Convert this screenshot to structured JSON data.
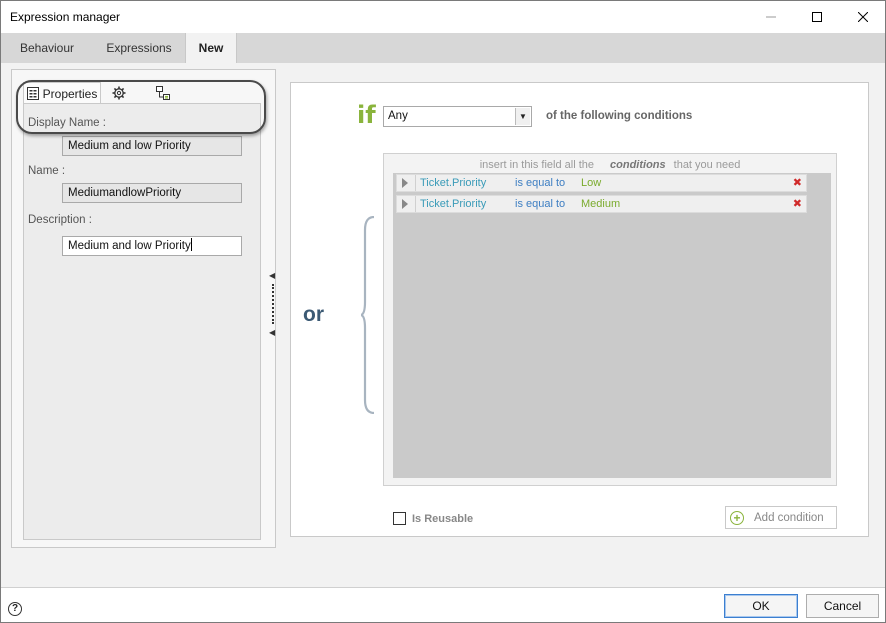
{
  "window": {
    "title": "Expression manager",
    "controls": {
      "minimize": "minimize-icon",
      "maximize": "maximize-icon",
      "close": "close-icon"
    }
  },
  "tabs": [
    {
      "label": "Behaviour",
      "active": false
    },
    {
      "label": "Expressions",
      "active": false
    },
    {
      "label": "New",
      "active": true
    }
  ],
  "left_panel": {
    "subtabs": [
      {
        "label": "Properties",
        "icon": "properties-icon"
      },
      {
        "label": "",
        "icon": "gear-icon"
      },
      {
        "label": "",
        "icon": "tree-icon"
      }
    ],
    "fields": {
      "display_name": {
        "label": "Display Name :",
        "value": "Medium and low Priority"
      },
      "name": {
        "label": "Name :",
        "value": "MediumandlowPriority"
      },
      "description": {
        "label": "Description :",
        "value": "Medium and low Priority"
      }
    }
  },
  "right_panel": {
    "if_label": "if",
    "match_mode": {
      "selected": "Any"
    },
    "following_text": "of the following conditions",
    "or_label": "or",
    "conditions_header": {
      "before": "insert in this field all the",
      "emphasis": "conditions",
      "after": "that you need"
    },
    "conditions": [
      {
        "field": "Ticket.Priority",
        "operator": "is equal to",
        "value": "Low"
      },
      {
        "field": "Ticket.Priority",
        "operator": "is equal to",
        "value": "Medium"
      }
    ],
    "is_reusable": {
      "label": "Is Reusable",
      "checked": false
    },
    "add_condition": {
      "label": "Add condition"
    }
  },
  "footer": {
    "help": "?",
    "ok_label": "OK",
    "cancel_label": "Cancel"
  },
  "colors": {
    "if_green": "#8ab43c",
    "or_blue": "#3c5a74",
    "field_teal": "#3a9bb8",
    "operator_blue": "#3d7ec2",
    "value_green": "#7aab2d",
    "delete_red": "#d02a2a"
  }
}
